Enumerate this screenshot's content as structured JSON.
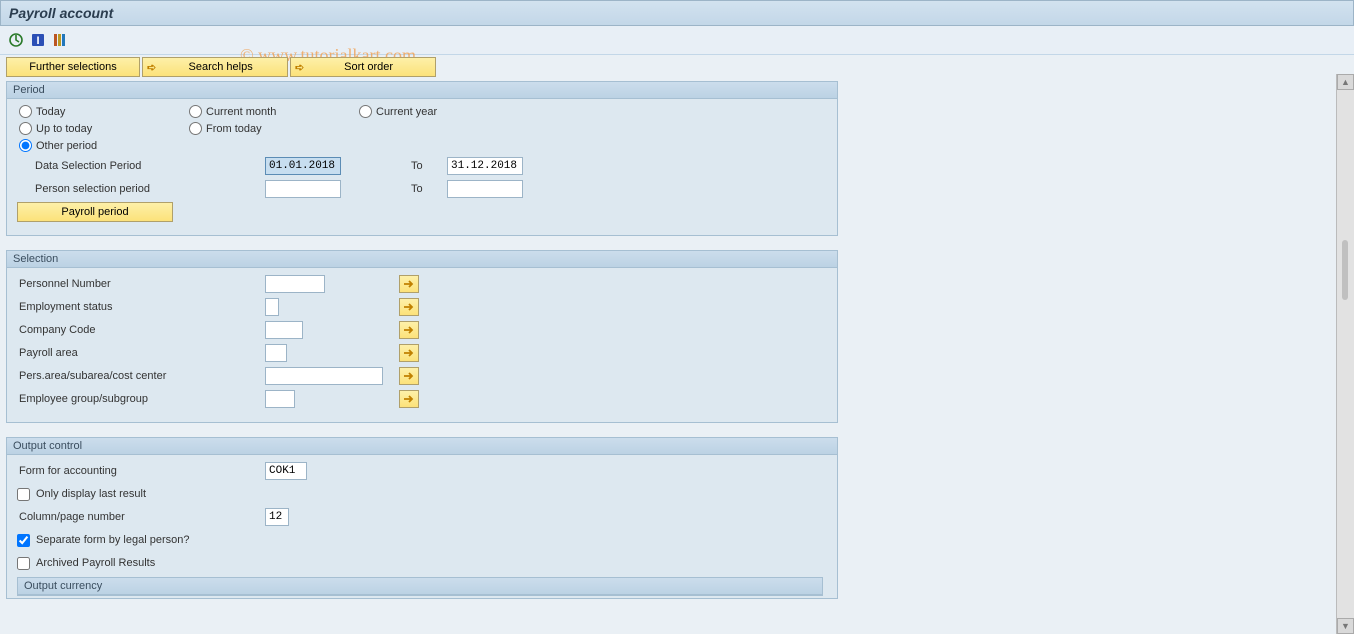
{
  "title": "Payroll account",
  "watermark": "© www.tutorialkart.com",
  "topButtons": {
    "further": "Further selections",
    "search": "Search helps",
    "sort": "Sort order"
  },
  "period": {
    "title": "Period",
    "radios": {
      "today": "Today",
      "currentMonth": "Current month",
      "currentYear": "Current year",
      "upToToday": "Up to today",
      "fromToday": "From today",
      "otherPeriod": "Other period"
    },
    "dataSelLabel": "Data Selection Period",
    "dataSelFrom": "01.01.2018",
    "toLabel": "To",
    "dataSelTo": "31.12.2018",
    "personSelLabel": "Person selection period",
    "personSelFrom": "",
    "personSelTo": "",
    "payrollPeriodBtn": "Payroll period"
  },
  "selection": {
    "title": "Selection",
    "rows": {
      "personnelNumber": "Personnel Number",
      "employmentStatus": "Employment status",
      "companyCode": "Company Code",
      "payrollArea": "Payroll area",
      "persArea": "Pers.area/subarea/cost center",
      "employeeGroup": "Employee group/subgroup"
    }
  },
  "output": {
    "title": "Output control",
    "formForAccountingLabel": "Form for accounting",
    "formForAccountingValue": "COK1",
    "onlyDisplayLast": "Only display last result",
    "columnPageLabel": "Column/page number",
    "columnPageValue": "12",
    "separateForm": "Separate form by legal person?",
    "archived": "Archived Payroll Results",
    "outputCurrency": "Output currency"
  }
}
